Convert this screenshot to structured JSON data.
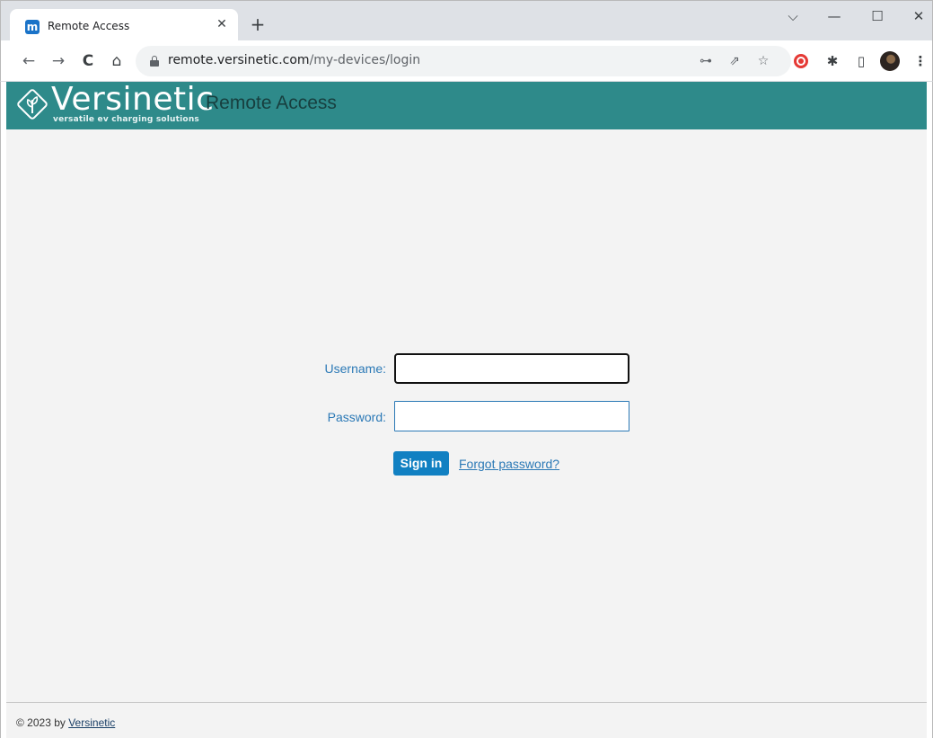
{
  "browser": {
    "tab": {
      "title": "Remote Access",
      "favicon_letter": "m",
      "close_glyph": "✕"
    },
    "new_tab_glyph": "+",
    "window_controls": {
      "tab_search": "⌵",
      "minimize": "—",
      "maximize": "☐",
      "close": "✕"
    },
    "nav": {
      "back": "←",
      "forward": "→",
      "reload": "C",
      "home": "⌂"
    },
    "url": {
      "domain": "remote.versinetic.com",
      "path": "/my-devices/login"
    },
    "omnibox_icons": {
      "key": "⊶",
      "share": "⇗",
      "bookmark": "☆"
    },
    "toolbar_icons": {
      "extensions": "✱",
      "side_panel": "▯",
      "menu": "⋮"
    }
  },
  "site": {
    "brand_name": "Versinetic",
    "tagline": "versatile ev charging solutions",
    "app_name": "Remote Access",
    "brand_color": "#2e8a8a"
  },
  "login": {
    "username_label": "Username:",
    "username_value": "",
    "password_label": "Password:",
    "password_value": "",
    "signin_label": "Sign in",
    "forgot_label": "Forgot password?"
  },
  "footer": {
    "copyright_prefix": "© 2023 by ",
    "company_link": "Versinetic"
  }
}
